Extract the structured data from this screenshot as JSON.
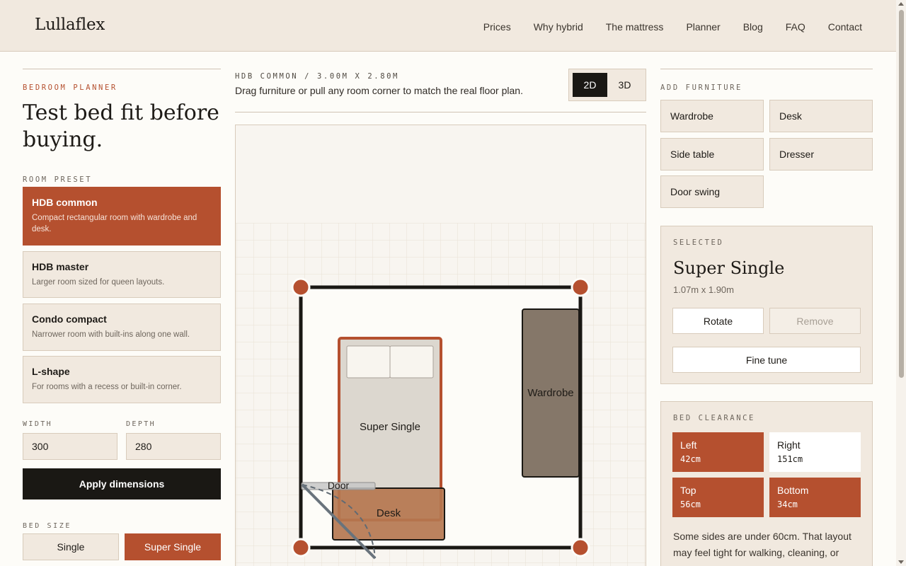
{
  "header": {
    "logo": "Lullaflex",
    "nav": [
      "Prices",
      "Why hybrid",
      "The mattress",
      "Planner",
      "Blog",
      "FAQ",
      "Contact"
    ]
  },
  "planner": {
    "eyebrow": "BEDROOM PLANNER",
    "headline": "Test bed fit before buying.",
    "preset_eyebrow": "ROOM PRESET",
    "presets": [
      {
        "title": "HDB common",
        "desc": "Compact rectangular room with wardrobe and desk.",
        "active": true
      },
      {
        "title": "HDB master",
        "desc": "Larger room sized for queen layouts.",
        "active": false
      },
      {
        "title": "Condo compact",
        "desc": "Narrower room with built-ins along one wall.",
        "active": false
      },
      {
        "title": "L-shape",
        "desc": "For rooms with a recess or built-in corner.",
        "active": false
      }
    ],
    "width_label": "WIDTH",
    "width_value": "300",
    "depth_label": "DEPTH",
    "depth_value": "280",
    "apply_label": "Apply dimensions",
    "bed_size_eyebrow": "BED SIZE",
    "bed_sizes": [
      {
        "label": "Single",
        "active": false
      },
      {
        "label": "Super Single",
        "active": true
      }
    ]
  },
  "room": {
    "eyebrow": "HDB COMMON / 3.00M X 2.80M",
    "help": "Drag furniture or pull any room corner to match the real floor plan.",
    "view_2d": "2D",
    "view_3d": "3D",
    "bed_label": "Super Single",
    "wardrobe_label": "Wardrobe",
    "desk_label": "Desk",
    "door_label": "Door"
  },
  "furniture": {
    "eyebrow": "ADD FURNITURE",
    "items": [
      "Wardrobe",
      "Desk",
      "Side table",
      "Dresser",
      "Door swing"
    ]
  },
  "selected": {
    "eyebrow": "SELECTED",
    "title": "Super Single",
    "dims": "1.07m x 1.90m",
    "rotate_label": "Rotate",
    "remove_label": "Remove",
    "fine_tune_label": "Fine tune"
  },
  "clearance": {
    "eyebrow": "BED CLEARANCE",
    "left_label": "Left",
    "left_value": "42cm",
    "right_label": "Right",
    "right_value": "151cm",
    "top_label": "Top",
    "top_value": "56cm",
    "bottom_label": "Bottom",
    "bottom_value": "34cm",
    "note": "Some sides are under 60cm. That layout may feel tight for walking, cleaning, or"
  },
  "colors": {
    "accent": "#b5502f",
    "dark": "#1a1814",
    "panel": "#f1e9df",
    "wardrobe": "#857769",
    "desk": "#b57750"
  }
}
